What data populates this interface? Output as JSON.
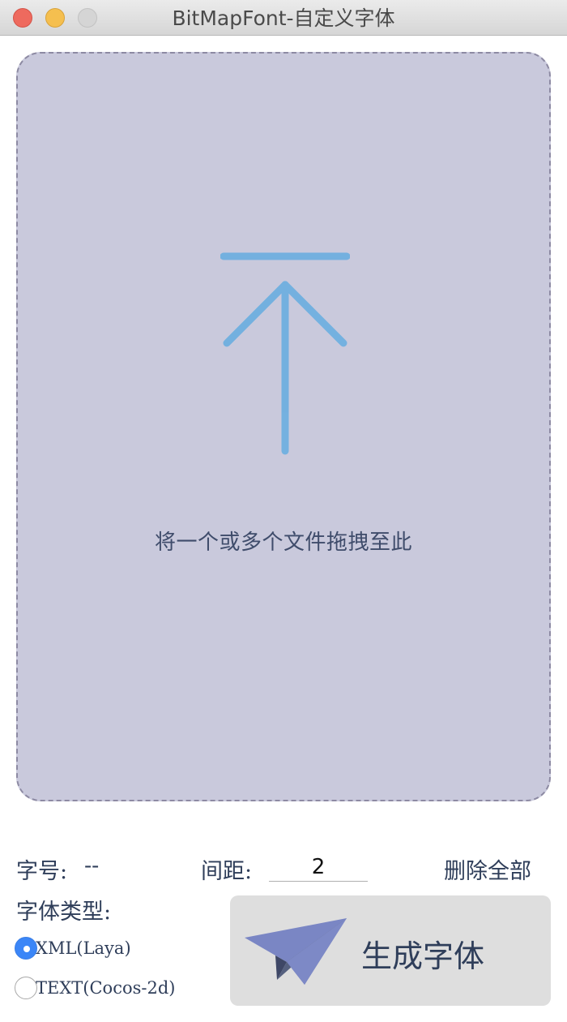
{
  "window": {
    "title": "BitMapFont-自定义字体"
  },
  "dropzone": {
    "hint": "将一个或多个文件拖拽至此",
    "icon": "upload-arrow-icon",
    "background_color": "#c9c9dc",
    "icon_color": "#6aaee0"
  },
  "controls": {
    "font_size_label": "字号:",
    "font_size_value": "--",
    "spacing_label": "间距:",
    "spacing_value": "2",
    "delete_all_label": "删除全部",
    "font_type_label": "字体类型:",
    "font_types": [
      {
        "label": "XML(Laya)",
        "selected": true
      },
      {
        "label": "TEXT(Cocos-2d)",
        "selected": false
      }
    ],
    "generate_label": "生成字体",
    "generate_icon": "paper-plane-icon"
  },
  "colors": {
    "accent": "#3b86f7",
    "text": "#2f3e5a"
  }
}
